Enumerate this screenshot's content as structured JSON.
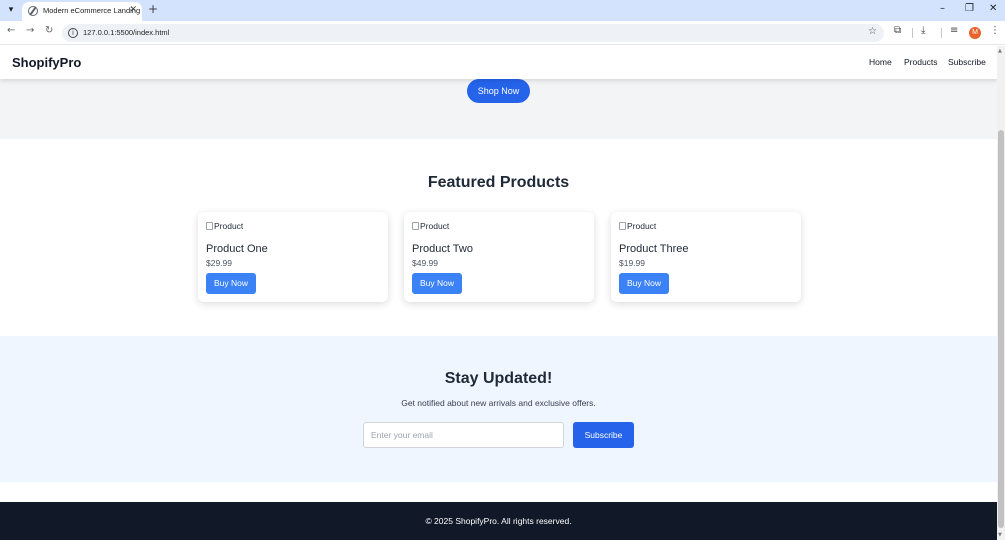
{
  "browser": {
    "tab_title": "Modern eCommerce Landing",
    "tab_list_icon": "chevron-down",
    "new_tab_icon": "plus",
    "url": "127.0.0.1:5500/index.html",
    "profile_initial": "M"
  },
  "header": {
    "logo": "ShopifyPro",
    "nav": [
      "Home",
      "Products",
      "Subscribe"
    ]
  },
  "hero": {
    "cta": "Shop Now"
  },
  "featured": {
    "title": "Featured Products",
    "products": [
      {
        "img_alt": "Product",
        "name": "Product One",
        "price": "$29.99",
        "button": "Buy Now"
      },
      {
        "img_alt": "Product",
        "name": "Product Two",
        "price": "$49.99",
        "button": "Buy Now"
      },
      {
        "img_alt": "Product",
        "name": "Product Three",
        "price": "$19.99",
        "button": "Buy Now"
      }
    ]
  },
  "newsletter": {
    "title": "Stay Updated!",
    "subtitle": "Get notified about new arrivals and exclusive offers.",
    "email_placeholder": "Enter your email",
    "button": "Subscribe"
  },
  "footer": {
    "text": "© 2025 ShopifyPro. All rights reserved."
  },
  "colors": {
    "primary": "#2563eb",
    "button": "#3b82f6",
    "footer_bg": "#111827",
    "newsletter_bg": "#eff6ff",
    "hero_bg": "#f3f4f6",
    "tabbar_bg": "#d3e3fd"
  }
}
